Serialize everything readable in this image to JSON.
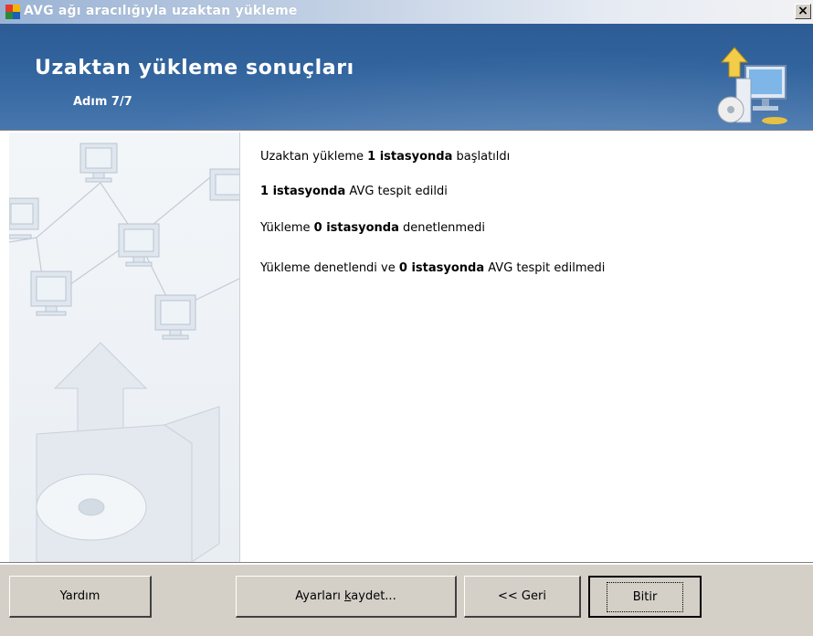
{
  "window": {
    "title": "AVG ağı aracılığıyla uzaktan yükleme",
    "close_glyph": "×"
  },
  "header": {
    "title": "Uzaktan yükleme sonuçları",
    "step": "Adım 7/7",
    "icon": "install-computer-icon"
  },
  "results": [
    {
      "pre": "Uzaktan yükleme ",
      "bold": "1 istasyonda",
      "post": " başlatıldı"
    },
    {
      "pre": "",
      "bold": "1 istasyonda",
      "post": " AVG tespit edildi"
    },
    {
      "pre": "Yükleme ",
      "bold": "0 istasyonda",
      "post": " denetlenmedi"
    },
    {
      "pre": "Yükleme denetlendi ve ",
      "bold": "0 istasyonda",
      "post": " AVG tespit edilmedi"
    }
  ],
  "buttons": {
    "help": "Yardım",
    "save_pre": "Ayarları ",
    "save_accel": "k",
    "save_post": "aydet...",
    "back": "<< Geri",
    "finish": "Bitir"
  },
  "colors": {
    "banner": "#31639d",
    "face": "#d4d0c8"
  }
}
